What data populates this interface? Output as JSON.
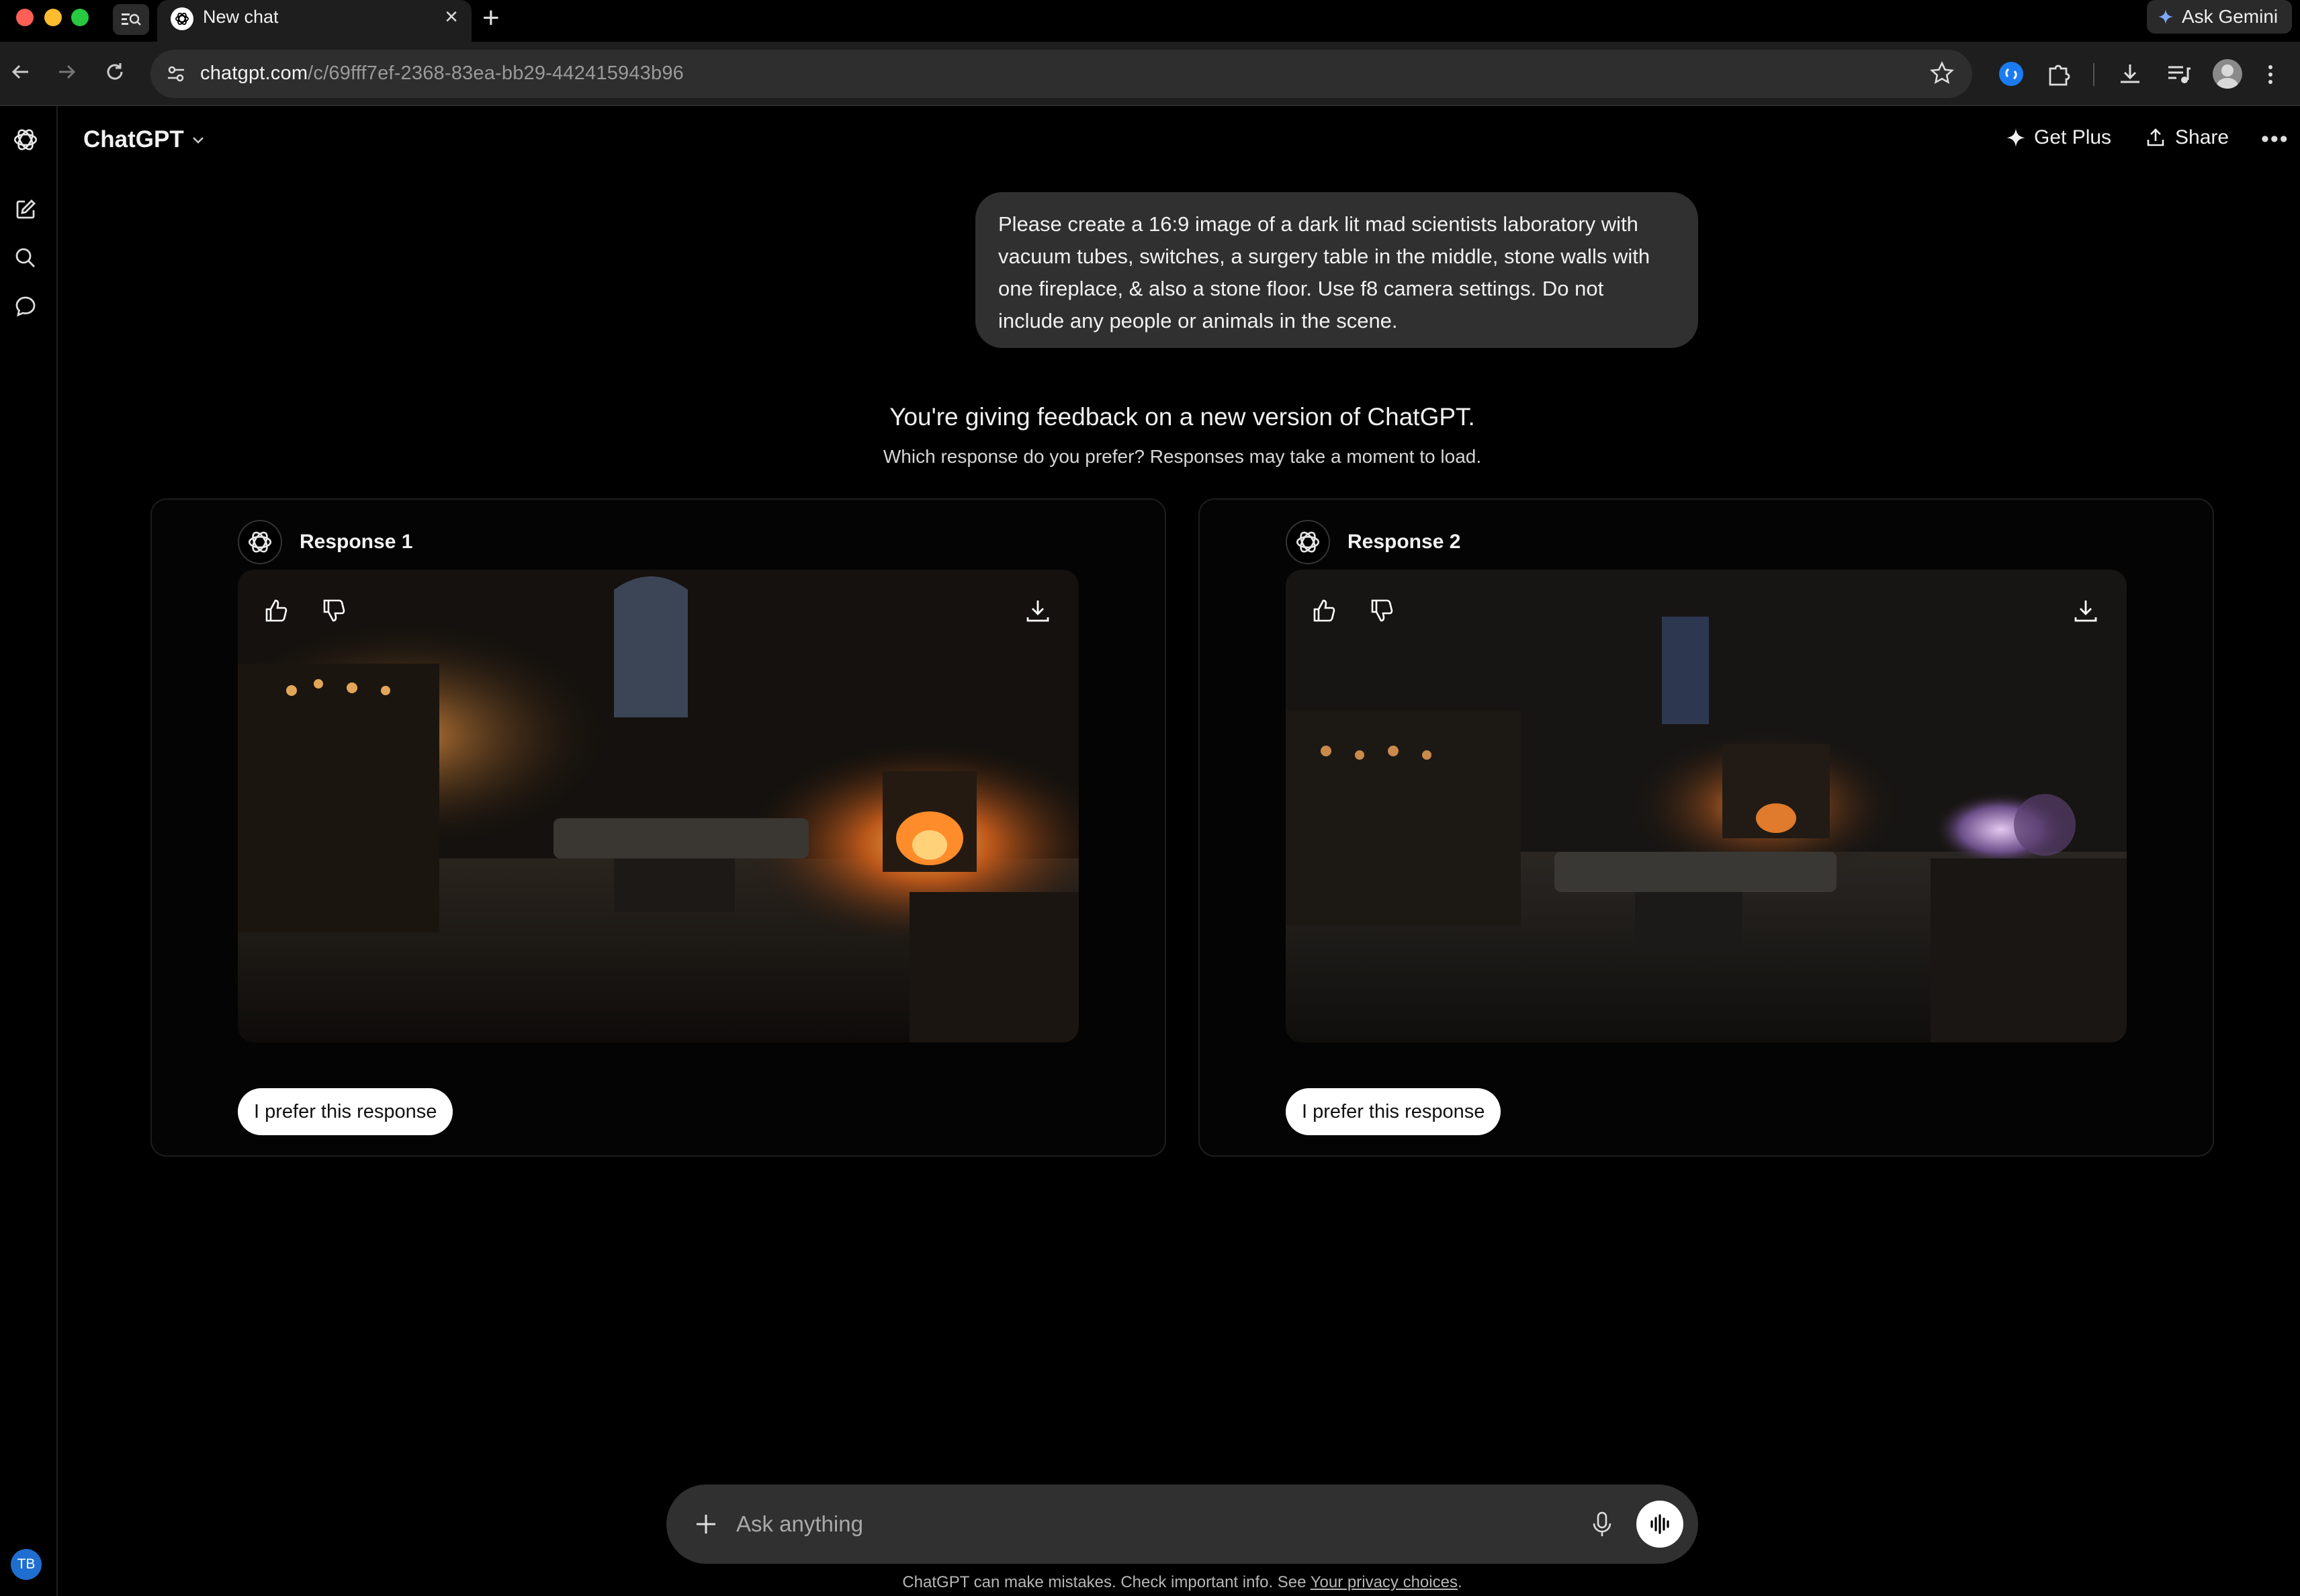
{
  "browser": {
    "tab_title": "New chat",
    "url_host": "chatgpt.com",
    "url_path": "/c/69fff7ef-2368-83ea-bb29-442415943b96",
    "ask_gemini_label": "Ask Gemini"
  },
  "header": {
    "model_label": "ChatGPT",
    "get_plus_label": "Get Plus",
    "share_label": "Share"
  },
  "sidebar": {
    "avatar_initials": "TB"
  },
  "conversation": {
    "user_message": "Please create a 16:9 image of a dark lit mad scientists laboratory with vacuum tubes, switches, a surgery table in the middle, stone walls with one fireplace, & also a stone floor.  Use f8 camera settings.  Do not include any people or animals in the scene."
  },
  "feedback": {
    "title": "You're giving feedback on a new version of ChatGPT.",
    "subtitle": "Which response do you prefer? Responses may take a moment to load.",
    "responses": [
      {
        "label": "Response 1",
        "prefer_label": "I prefer this response"
      },
      {
        "label": "Response 2",
        "prefer_label": "I prefer this response"
      }
    ]
  },
  "composer": {
    "placeholder": "Ask anything"
  },
  "footer": {
    "disclaimer_prefix": "ChatGPT can make mistakes. Check important info. See ",
    "privacy_link": "Your privacy choices",
    "disclaimer_suffix": "."
  },
  "colors": {
    "background": "#000000",
    "bubble": "#303030",
    "accent_avatar": "#1f6fd1"
  }
}
